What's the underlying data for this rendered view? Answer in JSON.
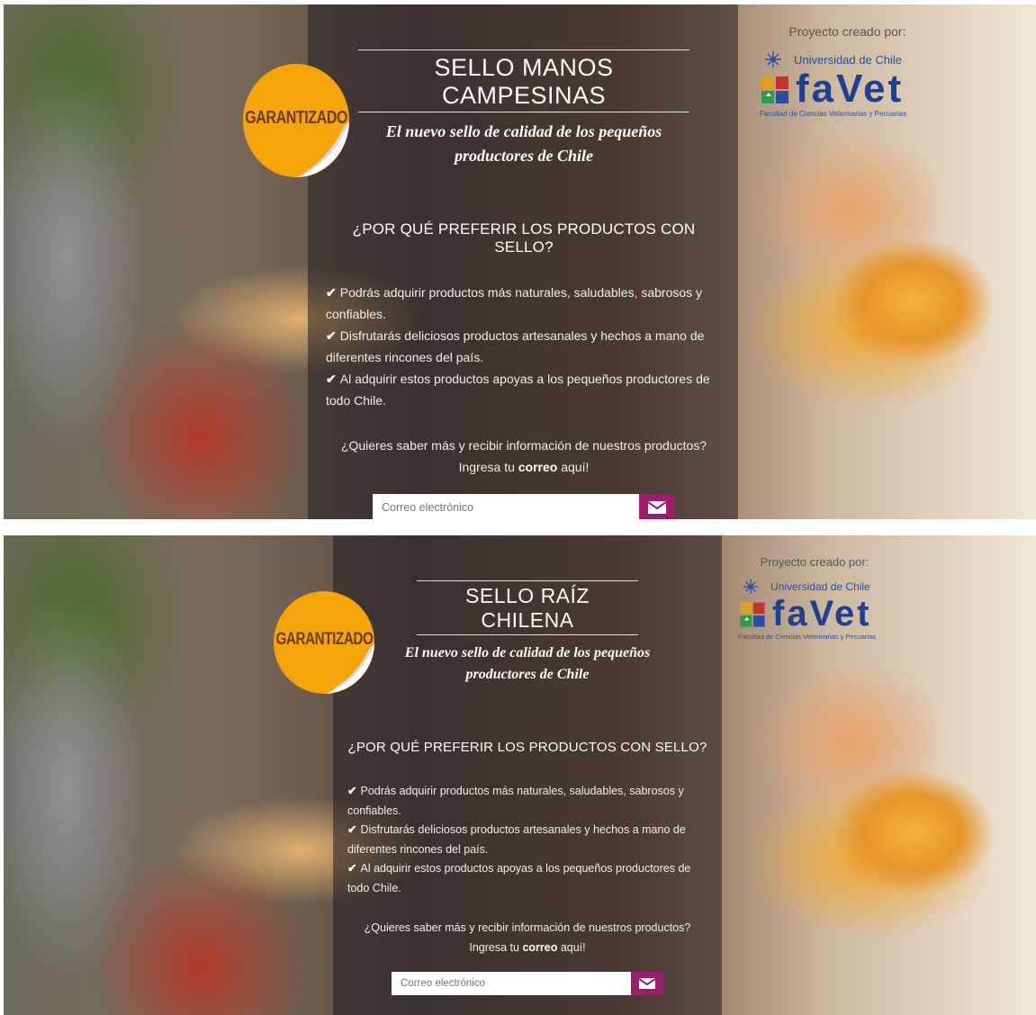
{
  "panels": [
    {
      "title": "SELLO MANOS CAMPESINAS",
      "subtitle": "El nuevo sello de calidad de los pequeños productores de Chile",
      "badge": "GARANTIZADO",
      "why_heading": "¿POR QUÉ PREFERIR LOS PRODUCTOS CON SELLO?",
      "benefits": [
        "Podrás adquirir productos más naturales, saludables, sabrosos y confiables.",
        "Disfrutarás deliciosos productos artesanales y hechos a mano de diferentes rincones del país.",
        "Al adquirir estos productos apoyas a los pequeños productores de todo Chile."
      ],
      "cta_line1": "¿Quieres saber más y recibir información de nuestros productos?",
      "cta_line2_pre": "Ingresa tu",
      "cta_line2_bold": "correo",
      "cta_line2_post": "aquí!",
      "email_placeholder": "Correo electrónico",
      "created_by": "Proyecto creado por:",
      "university": "Universidad de Chile",
      "logo_word": "faVet",
      "faculty": "Facultad de Ciencias Veterinarias y Pecuarias"
    },
    {
      "title": "SELLO RAÍZ CHILENA",
      "subtitle": "El nuevo sello de calidad de los pequeños productores de Chile",
      "badge": "GARANTIZADO",
      "why_heading": "¿POR QUÉ PREFERIR LOS PRODUCTOS CON SELLO?",
      "benefits": [
        "Podrás adquirir productos más naturales, saludables, sabrosos y confiables.",
        "Disfrutarás deliciosos productos artesanales y hechos a mano de diferentes rincones del país.",
        "Al adquirir estos productos apoyas a los pequeños productores de todo Chile."
      ],
      "cta_line1": "¿Quieres saber más y recibir información de nuestros productos?",
      "cta_line2_pre": "Ingresa tu",
      "cta_line2_bold": "correo",
      "cta_line2_post": "aquí!",
      "email_placeholder": "Correo electrónico",
      "created_by": "Proyecto creado por:",
      "university": "Universidad de Chile",
      "logo_word": "faVet",
      "faculty": "Facultad de Ciencias Veterinarias y Pecuarias"
    }
  ],
  "icons": {
    "check": "check-icon",
    "send": "envelope-icon",
    "uni_crest": "university-crest-icon"
  },
  "colors": {
    "badge": "#f5a50a",
    "send_button": "#9c1f6e",
    "logo_blue": "#1f3f8f"
  }
}
